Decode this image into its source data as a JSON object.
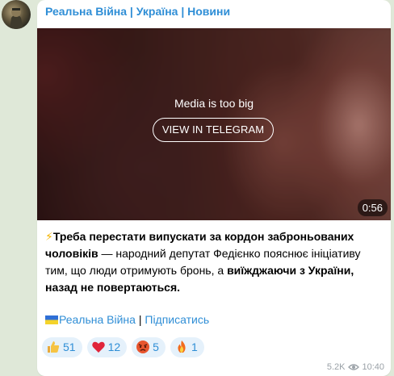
{
  "channel": {
    "name": "Реальна Війна | Україна | Новини"
  },
  "media": {
    "message": "Media is too big",
    "button_label": "VIEW IN TELEGRAM",
    "duration": "0:56"
  },
  "post": {
    "p1_icon": "⚡",
    "p1_bold": "Треба перестати випускати за кордон заброньованих чоловіків",
    "p1_normal": " — народний депутат Федієнко пояснює ініціативу тим, що люди отримують бронь, а ",
    "p1_bold2": "виїжджаючи з України, назад не повертаються.",
    "signature_flag": "ukraine-flag",
    "signature_link1": "Реальна Війна",
    "signature_sep": " | ",
    "signature_link2": "Підписатись"
  },
  "reactions": [
    {
      "icon": "thumbs-up-icon",
      "count": "51"
    },
    {
      "icon": "heart-icon",
      "count": "12"
    },
    {
      "icon": "angry-face-icon",
      "count": "5"
    },
    {
      "icon": "fire-icon",
      "count": "1"
    }
  ],
  "meta": {
    "views": "5.2K",
    "time": "10:40"
  },
  "colors": {
    "accent": "#2f8ed6",
    "background": "#dfe8d8",
    "reaction_bg": "#e5f1fb",
    "meta_text": "#9aa1a7"
  }
}
